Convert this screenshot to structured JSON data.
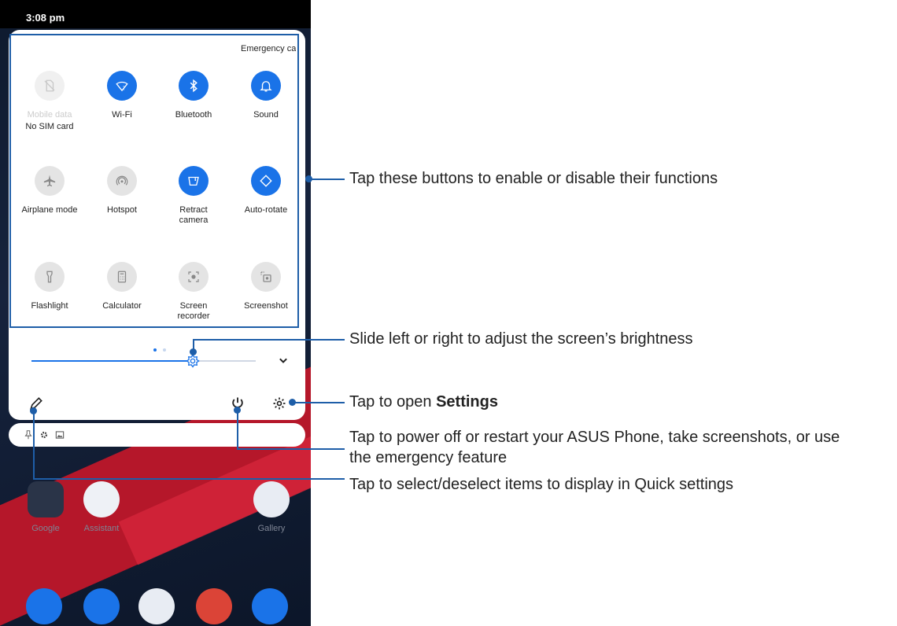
{
  "status_bar": {
    "time": "3:08 pm"
  },
  "quick_settings": {
    "emergency_label": "Emergency ca",
    "tiles": [
      {
        "name": "mobile-data",
        "sublabel": "Mobile data",
        "label": "No SIM card",
        "state": "off",
        "icon": "no-sim-icon"
      },
      {
        "name": "wifi",
        "label": "Wi-Fi",
        "state": "on",
        "icon": "wifi-icon"
      },
      {
        "name": "bluetooth",
        "label": "Bluetooth",
        "state": "on",
        "icon": "bluetooth-icon"
      },
      {
        "name": "sound",
        "label": "Sound",
        "state": "on",
        "icon": "bell-icon"
      },
      {
        "name": "airplane-mode",
        "label": "Airplane mode",
        "state": "off",
        "icon": "airplane-icon"
      },
      {
        "name": "hotspot",
        "label": "Hotspot",
        "state": "off",
        "icon": "hotspot-icon"
      },
      {
        "name": "retract-camera",
        "label": "Retract\ncamera",
        "state": "on",
        "icon": "camera-flip-icon"
      },
      {
        "name": "auto-rotate",
        "label": "Auto-rotate",
        "state": "on",
        "icon": "rotate-icon"
      },
      {
        "name": "flashlight",
        "label": "Flashlight",
        "state": "off",
        "icon": "flashlight-icon"
      },
      {
        "name": "calculator",
        "label": "Calculator",
        "state": "off",
        "icon": "calculator-icon"
      },
      {
        "name": "screen-recorder",
        "label": "Screen\nrecorder",
        "state": "off",
        "icon": "screen-record-icon"
      },
      {
        "name": "screenshot",
        "label": "Screenshot",
        "state": "off",
        "icon": "screenshot-icon"
      }
    ],
    "brightness_level": 0.72
  },
  "home_apps": [
    {
      "label": "Google"
    },
    {
      "label": "Assistant"
    },
    {
      "label": "Gallery"
    }
  ],
  "colors": {
    "accent": "#1a73e8",
    "callout": "#1e5ea8"
  },
  "callouts": {
    "tiles": "Tap these buttons to enable or disable their functions",
    "brightness": "Slide left or right to adjust the screen’s brightness",
    "settings_prefix": "Tap to open ",
    "settings_bold": "Settings",
    "power_line1": "Tap to power off or restart your ASUS Phone, take screenshots, or use",
    "power_line2": "the emergency feature",
    "edit": "Tap to select/deselect items to display in Quick settings"
  }
}
